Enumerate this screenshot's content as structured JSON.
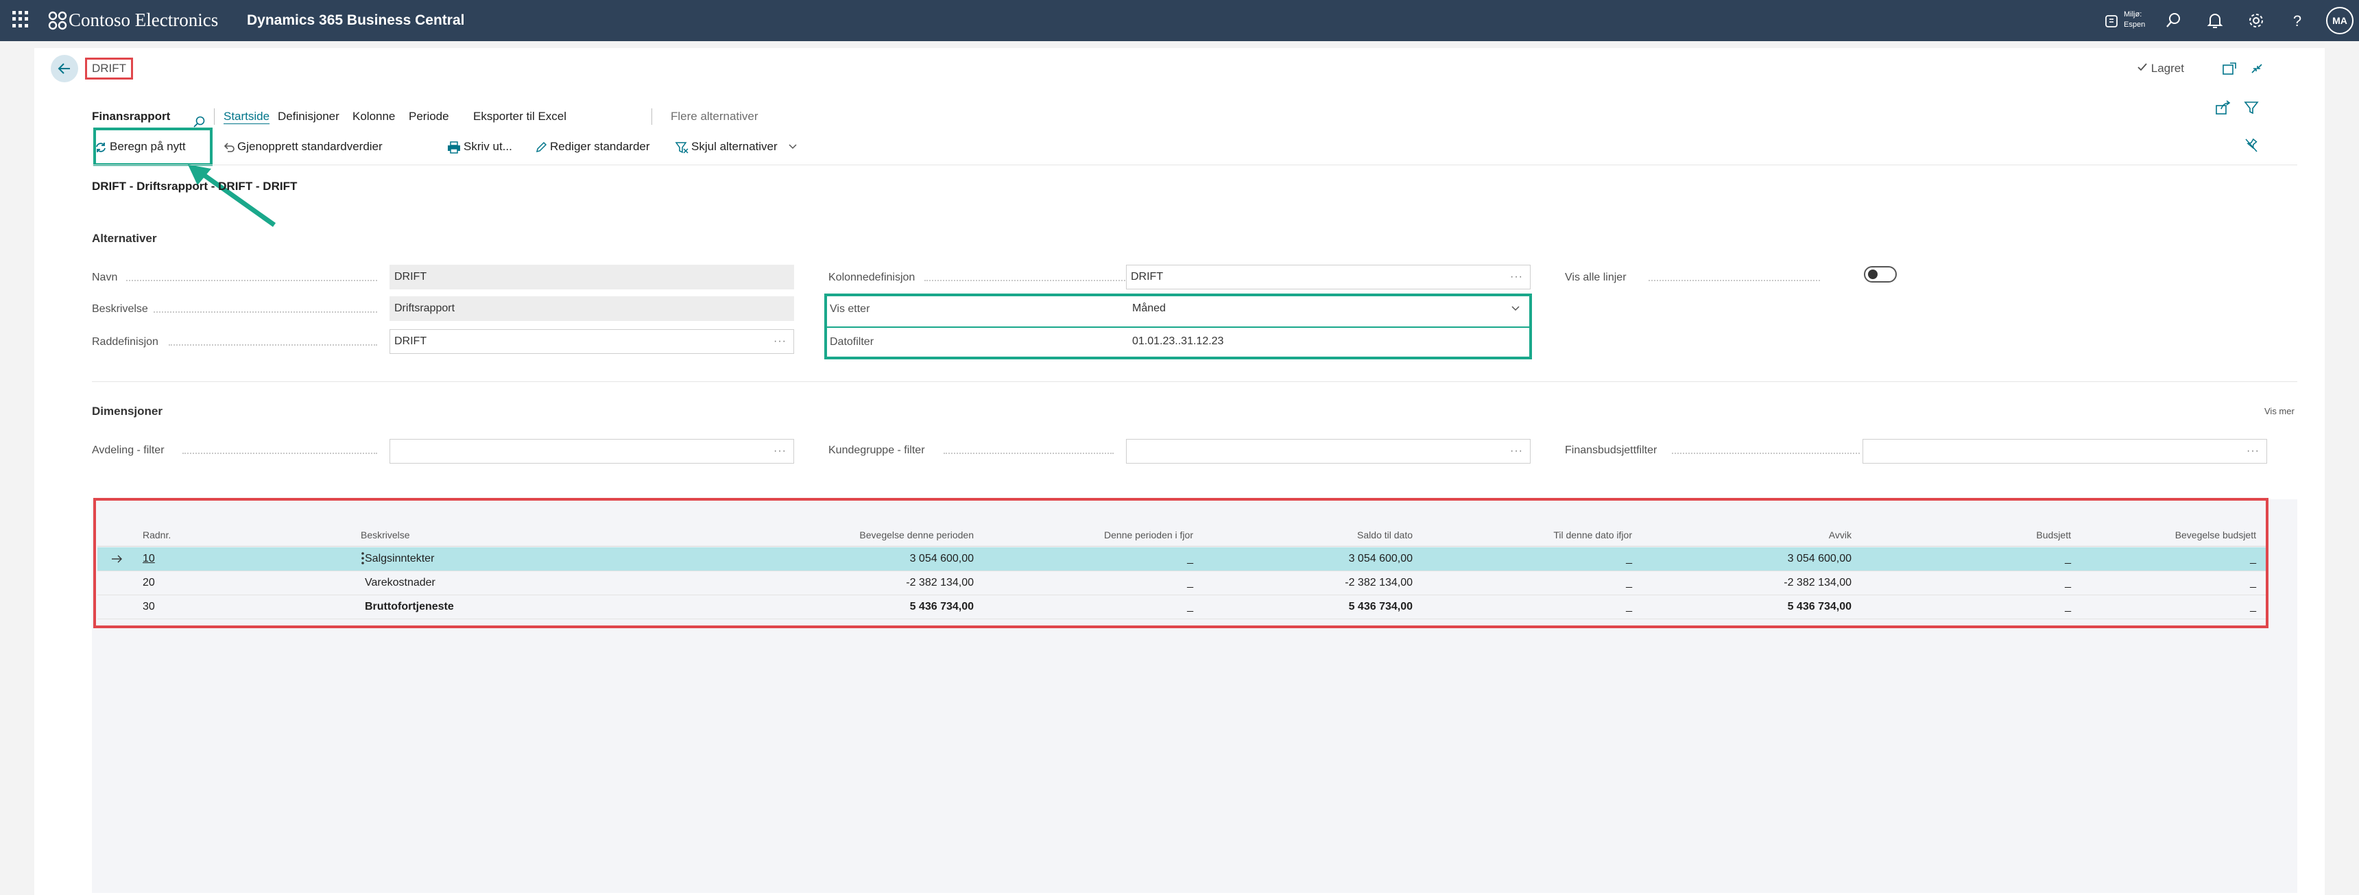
{
  "app": {
    "brand": "Contoso Electronics",
    "product": "Dynamics 365 Business Central",
    "environment_label": "Miljø:",
    "environment_value": "Espen",
    "avatar_initials": "MA"
  },
  "page": {
    "caption": "DRIFT",
    "saved_label": "Lagret"
  },
  "actionbar": {
    "items": [
      "Finansrapport",
      "Startside",
      "Definisjoner",
      "Kolonne",
      "Periode",
      "Eksporter til Excel",
      "Flere alternativer"
    ]
  },
  "toolbar": {
    "recalc": "Beregn på nytt",
    "restore": "Gjenopprett standardverdier",
    "print": "Skriv ut...",
    "edit_defaults": "Rediger standarder",
    "hide_options": "Skjul alternativer"
  },
  "report_title": "DRIFT - Driftsrapport - DRIFT - DRIFT",
  "options": {
    "title": "Alternativer",
    "name_label": "Navn",
    "name_value": "DRIFT",
    "description_label": "Beskrivelse",
    "description_value": "Driftsrapport",
    "row_def_label": "Raddefinisjon",
    "row_def_value": "DRIFT",
    "col_def_label": "Kolonnedefinisjon",
    "col_def_value": "DRIFT",
    "view_by_label": "Vis etter",
    "view_by_value": "Måned",
    "date_filter_label": "Datofilter",
    "date_filter_value": "01.01.23..31.12.23",
    "show_all_label": "Vis alle linjer",
    "show_all_on": false
  },
  "dimensions": {
    "title": "Dimensjoner",
    "more": "Vis mer",
    "dept_label": "Avdeling - filter",
    "dept_value": "",
    "custgroup_label": "Kundegruppe - filter",
    "custgroup_value": "",
    "budget_label": "Finansbudsjettfilter",
    "budget_value": ""
  },
  "table": {
    "columns": [
      "Radnr.",
      "Beskrivelse",
      "Bevegelse denne perioden",
      "Denne perioden i fjor",
      "Saldo til dato",
      "Til denne dato ifjor",
      "Avvik",
      "Budsjett",
      "Bevegelse budsjett"
    ],
    "rows": [
      {
        "no": "10",
        "desc": "Salgsinntekter",
        "mov": "3 054 600,00",
        "mov_ly": "_",
        "bal": "3 054 600,00",
        "bal_ly": "_",
        "var": "3 054 600,00",
        "budget": "_",
        "mov_budget": "_",
        "selected": true,
        "bold": false
      },
      {
        "no": "20",
        "desc": "Varekostnader",
        "mov": "-2 382 134,00",
        "mov_ly": "_",
        "bal": "-2 382 134,00",
        "bal_ly": "_",
        "var": "-2 382 134,00",
        "budget": "_",
        "mov_budget": "_",
        "selected": false,
        "bold": false
      },
      {
        "no": "30",
        "desc": "Bruttofortjeneste",
        "mov": "5 436 734,00",
        "mov_ly": "_",
        "bal": "5 436 734,00",
        "bal_ly": "_",
        "var": "5 436 734,00",
        "budget": "_",
        "mov_budget": "_",
        "selected": false,
        "bold": true
      }
    ]
  },
  "colors": {
    "topbar": "#2f4259",
    "accent": "#00758a",
    "highlight_green": "#1aa88b",
    "highlight_red": "#e0474c",
    "selected_row": "#b4e4e8"
  }
}
